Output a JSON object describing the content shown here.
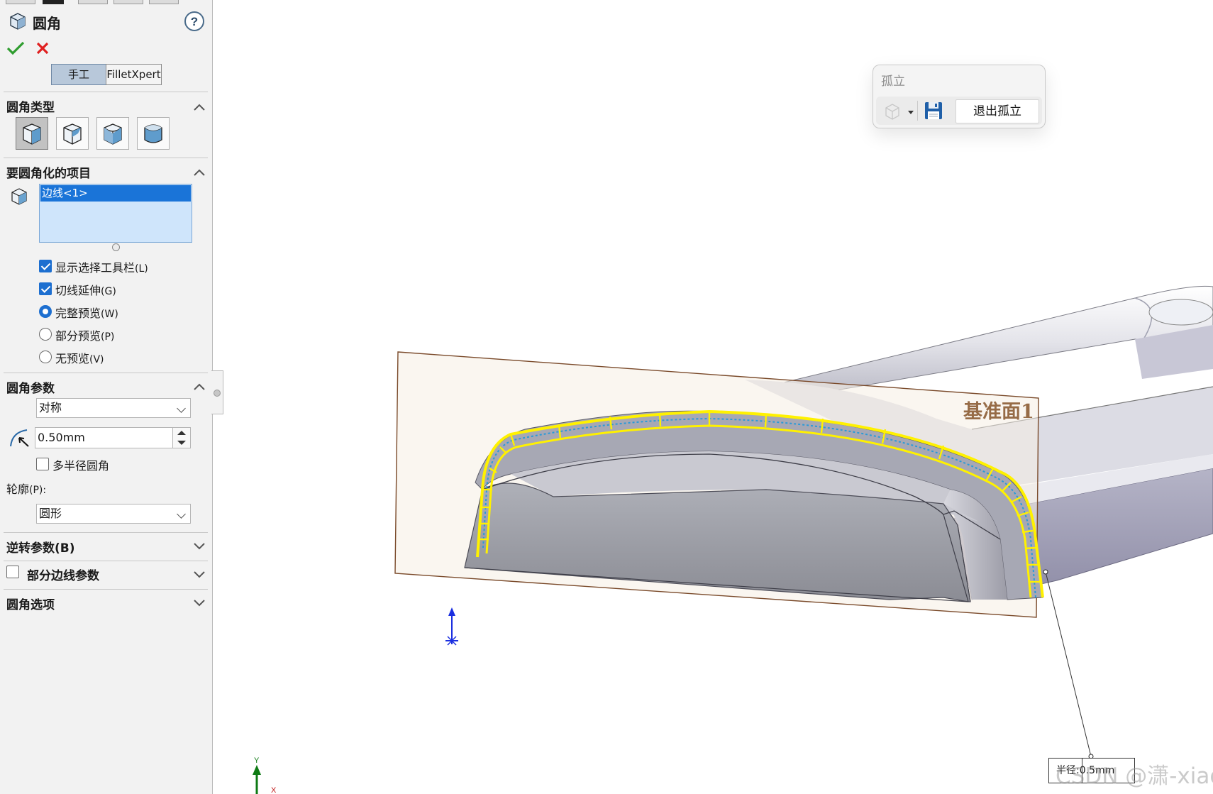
{
  "panel": {
    "title": "圆角",
    "help_icon": "question-mark",
    "ok_icon": "green-check",
    "cancel_icon": "red-x",
    "mode_tabs": [
      "手工",
      "FilletXpert"
    ],
    "active_mode": "手工",
    "sections": {
      "fillet_type": {
        "title": "圆角类型",
        "state": "expanded"
      },
      "items": {
        "title": "要圆角化的项目",
        "state": "expanded",
        "selection": [
          "边线<1>"
        ],
        "options": [
          {
            "type": "checkbox",
            "label": "显示选择工具栏",
            "key": "(L)",
            "checked": true
          },
          {
            "type": "checkbox",
            "label": "切线延伸",
            "key": "(G)",
            "checked": true
          },
          {
            "type": "radio",
            "label": "完整预览",
            "key": "(W)",
            "checked": true
          },
          {
            "type": "radio",
            "label": "部分预览",
            "key": "(P)",
            "checked": false
          },
          {
            "type": "radio",
            "label": "无预览",
            "key": "(V)",
            "checked": false
          }
        ]
      },
      "params": {
        "title": "圆角参数",
        "state": "expanded",
        "method": "对称",
        "radius": "0.50mm",
        "multi_radius_label": "多半径圆角",
        "multi_radius_checked": false,
        "profile_label": "轮廓",
        "profile_key": "(P):",
        "profile_value": "圆形"
      },
      "setback": {
        "title": "逆转参数(B)",
        "state": "collapsed"
      },
      "partial_edge": {
        "title": "部分边线参数",
        "state": "collapsed",
        "checked": false
      },
      "fillet_options": {
        "title": "圆角选项",
        "state": "collapsed"
      }
    }
  },
  "isolate_popup": {
    "title": "孤立",
    "exit_label": "退出孤立",
    "icons": [
      "visibility-icon",
      "dropdown-arrow-icon",
      "save-icon"
    ]
  },
  "viewport": {
    "plane_label": "基准面1",
    "dimension_label": "半径:0.5mm",
    "watermark": "CSDN @潇-xiao",
    "triad_y": "Y",
    "triad_x": "X",
    "colors": {
      "selection_yellow": "#ffee00",
      "plane_outline": "#7a4a2a",
      "selected_blue": "#1a74d8"
    }
  }
}
